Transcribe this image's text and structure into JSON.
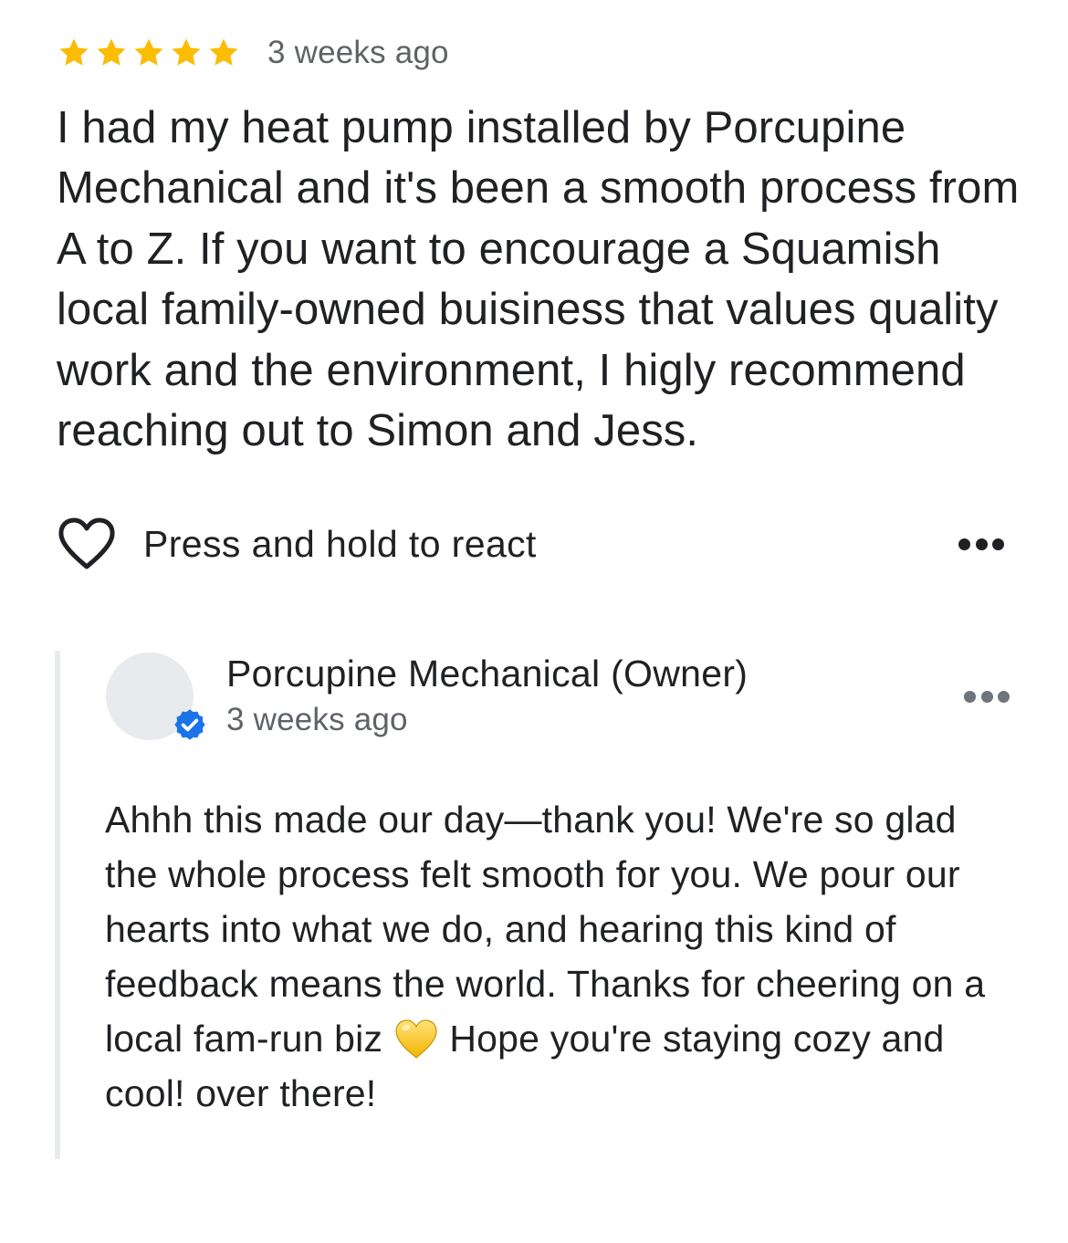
{
  "review": {
    "rating": 5,
    "rating_max": 5,
    "star_color": "#fbbc04",
    "date": "3 weeks ago",
    "text": "I had my heat pump installed by Porcupine Mechanical and it's been a smooth process from A to Z. If you want to encourage a Squamish local family-owned buisiness that values quality work and the environment, I higly recommend reaching out to Simon and Jess."
  },
  "react": {
    "label": "Press and hold to react",
    "icon": "heart-outline-icon",
    "more_icon": "more-horizontal-icon"
  },
  "owner_reply": {
    "name": "Porcupine Mechanical (Owner)",
    "date": "3 weeks ago",
    "verified_color": "#1a73e8",
    "more_icon": "more-horizontal-icon",
    "text_before_emoji": "Ahhh this made our day—thank you! We're so glad the whole process felt smooth for you. We pour our hearts into what we do, and hearing this kind of feedback means the world. Thanks for cheering on a local fam-run biz ",
    "emoji": "yellow-heart-emoji",
    "text_after_emoji": " Hope you're staying cozy and cool! over there!"
  }
}
